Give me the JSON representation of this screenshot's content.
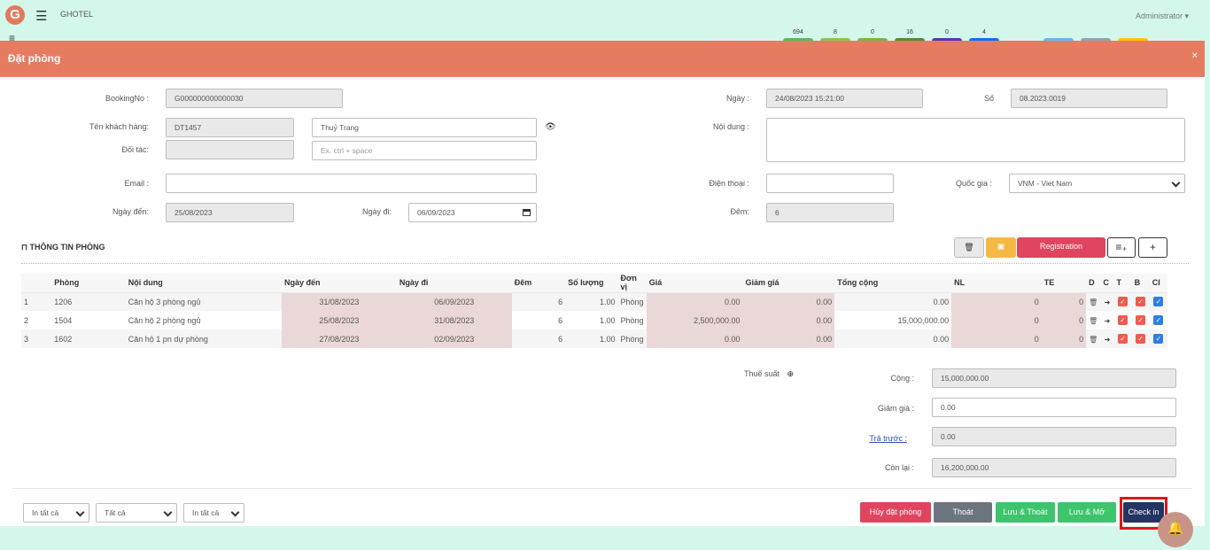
{
  "app": {
    "name": "GHOTEL",
    "user": "Administrator ▾",
    "logo": "G"
  },
  "status_counts": [
    {
      "value": "",
      "color": "#e9ecef"
    },
    {
      "value": "",
      "color": "#e9ecef"
    },
    {
      "value": "694",
      "color": "#5cb85c"
    },
    {
      "value": "8",
      "color": "#8bc34a"
    },
    {
      "value": "0",
      "color": "#7cb342"
    },
    {
      "value": "16",
      "color": "#558b2f"
    },
    {
      "value": "0",
      "color": "#5e35b1"
    },
    {
      "value": "4",
      "color": "#0d6efd"
    },
    {
      "value": "",
      "color": "#e9ecef"
    },
    {
      "value": "",
      "color": "#64b5f6"
    },
    {
      "value": "",
      "color": "#90a4ae"
    },
    {
      "value": "",
      "color": "#ffc107"
    },
    {
      "value": "",
      "color": "#e9ecef"
    }
  ],
  "modal": {
    "title": "Đặt phòng",
    "close": "×"
  },
  "form": {
    "booking_label": "BookingNo :",
    "booking_value": "G000000000000030",
    "customer_label": "Tên khách hàng:",
    "customer_code": "DT1457",
    "customer_name": "Thuỷ Trang",
    "partner_label": "Đối tác:",
    "partner_code": "",
    "partner_placeholder": "Ex. ctrl + space",
    "email_label": "Email :",
    "email_value": "",
    "arrive_label": "Ngày đến:",
    "arrive_value": "25/08/2023",
    "leave_label": "Ngày đi:",
    "leave_value": "06/09/2023",
    "date_label": "Ngày :",
    "date_value": "24/08/2023 15:21:00",
    "no_label": "Số",
    "no_value": "08.2023.0019",
    "content_label": "Nội dung :",
    "content_value": "",
    "phone_label": "Điện thoại :",
    "phone_value": "",
    "country_label": "Quốc gia :",
    "country_value": "VNM - Viet Nam",
    "nights_label": "Đêm:",
    "nights_value": "6"
  },
  "rooms_section": {
    "title": "THÔNG TIN PHÒNG",
    "registration_label": "Registration",
    "add_label": "+"
  },
  "table": {
    "headers": [
      "",
      "Phòng",
      "Nội dung",
      "Ngày đến",
      "Ngày đi",
      "Đêm",
      "Số lượng",
      "Đơn vị",
      "Giá",
      "Giảm giá",
      "Tổng cộng",
      "NL",
      "TE",
      "D",
      "C",
      "T",
      "B",
      "CI"
    ],
    "rows": [
      {
        "no": "1",
        "room": "1206",
        "desc": "Căn hộ 3 phòng ngủ",
        "arrive": "31/08/2023",
        "leave": "06/09/2023",
        "nights": "6",
        "qty": "1.00",
        "unit": "Phòng",
        "price": "0.00",
        "discount": "0.00",
        "total": "0.00",
        "adults": "0",
        "children": "0"
      },
      {
        "no": "2",
        "room": "1504",
        "desc": "Căn hộ 2 phòng ngủ",
        "arrive": "25/08/2023",
        "leave": "31/08/2023",
        "nights": "6",
        "qty": "1.00",
        "unit": "Phòng",
        "price": "2,500,000.00",
        "discount": "0.00",
        "total": "15,000,000.00",
        "adults": "0",
        "children": "0"
      },
      {
        "no": "3",
        "room": "1602",
        "desc": "Căn hộ 1 pn dự phòng",
        "arrive": "27/08/2023",
        "leave": "02/09/2023",
        "nights": "6",
        "qty": "1.00",
        "unit": "Phòng",
        "price": "0.00",
        "discount": "0.00",
        "total": "0.00",
        "adults": "0",
        "children": "0"
      }
    ]
  },
  "totals": {
    "tax_label": "Thuế suất",
    "sum_label": "Cộng :",
    "sum_value": "15,000,000.00",
    "discount_label": "Giảm giá :",
    "discount_value": "0.00",
    "prepaid_label": "Trả trước :",
    "prepaid_value": "0.00",
    "remain_label": "Còn lại :",
    "remain_value": "16,200,000.00"
  },
  "footer": {
    "print1": "In tất cả",
    "print2": "Tất cả",
    "print3": "In tất cả",
    "cancel": "Hủy đặt phòng",
    "exit": "Thoát",
    "save_exit": "Lưu & Thoát",
    "save_open": "Lưu & Mở",
    "checkin": "Check in"
  }
}
